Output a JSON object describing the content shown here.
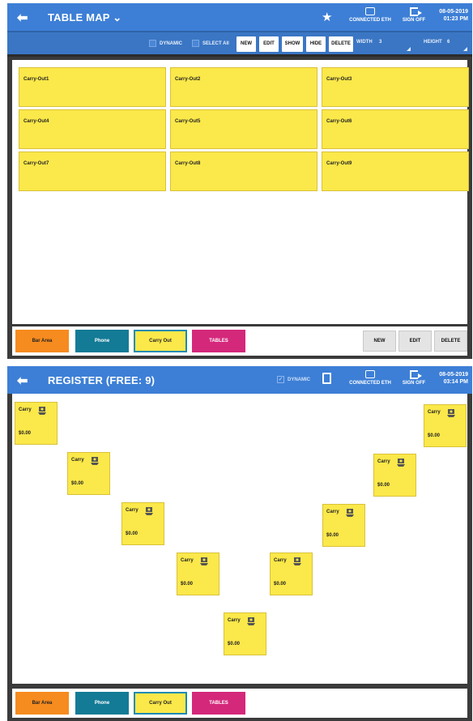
{
  "screen1": {
    "title": "TABLE MAP",
    "title_chevron": "⌄",
    "status": {
      "conn_label": "CONNECTED ETH",
      "signoff_label": "SIGN OFF",
      "date": "08-05-2019",
      "time": "01:23 PM"
    },
    "toolbar": {
      "dynamic": "DYNAMIC",
      "select_all": "SELECT All",
      "new": "NEW",
      "edit": "EDIT",
      "show": "SHOW",
      "hide": "HIDE",
      "delete": "DELETE",
      "width_label": "WIDTH",
      "width_value": "3",
      "height_label": "HEIGHT",
      "height_value": "6"
    },
    "tables": [
      "Carry-Out1",
      "Carry-Out2",
      "Carry-Out3",
      "Carry-Out4",
      "Carry-Out5",
      "Carry-Out6",
      "Carry-Out7",
      "Carry-Out8",
      "Carry-Out9"
    ],
    "bottom": {
      "tabs": [
        "Bar Area",
        "Phone",
        "Carry Out",
        "TABLES"
      ],
      "actions": [
        "NEW",
        "EDIT",
        "DELETE"
      ]
    }
  },
  "screen2": {
    "title": "REGISTER (FREE: 9)",
    "dynamic": "DYNAMIC",
    "status": {
      "conn_label": "CONNECTED ETH",
      "signoff_label": "SIGN OFF",
      "date": "08-05-2019",
      "time": "03:14 PM"
    },
    "tiles": [
      {
        "name": "Carry",
        "price": "$0.00"
      },
      {
        "name": "Carry",
        "price": "$0.00"
      },
      {
        "name": "Carry",
        "price": "$0.00"
      },
      {
        "name": "Carry",
        "price": "$0.00"
      },
      {
        "name": "Carry",
        "price": "$0.00"
      },
      {
        "name": "Carry",
        "price": "$0.00"
      },
      {
        "name": "Carry",
        "price": "$0.00"
      },
      {
        "name": "Carry",
        "price": "$0.00"
      },
      {
        "name": "Carry",
        "price": "$0.00"
      }
    ],
    "bottom": {
      "tabs": [
        "Bar Area",
        "Phone",
        "Carry Out",
        "TABLES"
      ]
    }
  },
  "colors": {
    "header_blue": "#3d7fd6",
    "table_yellow": "#fbe84a",
    "bar_area": "#f68b1f",
    "phone": "#137b96",
    "tables": "#d4287b"
  },
  "icons": [
    "back-arrow-icon",
    "star-icon",
    "network-icon",
    "sign-off-icon",
    "clipboard-icon",
    "takeout-bag-icon"
  ]
}
